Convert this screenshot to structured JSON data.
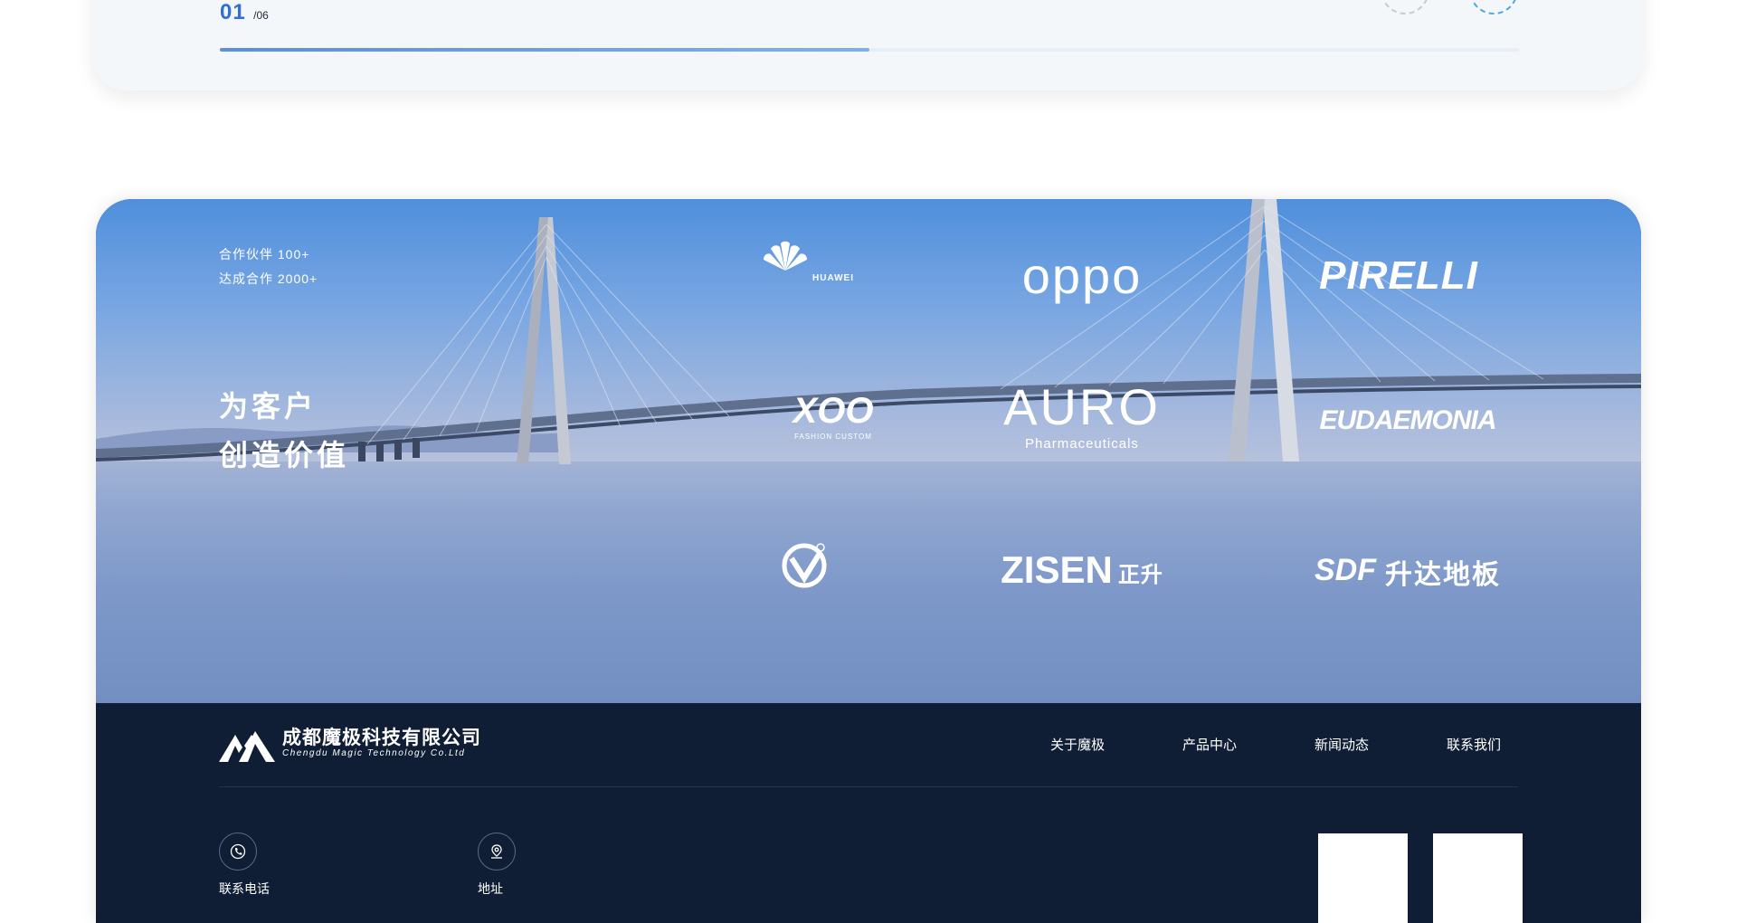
{
  "slider": {
    "current": "01",
    "total": "/06",
    "progress": 0.5
  },
  "stats": {
    "partners": "合作伙伴 100+",
    "deals": "达成合作 2000+"
  },
  "slogan": {
    "line1": "为客户",
    "line2": "创造价值"
  },
  "partners": [
    {
      "name": "HUAWEI"
    },
    {
      "name": "oppo"
    },
    {
      "name": "PIRELLI"
    },
    {
      "name": "XOO",
      "sub": "FASHION CUSTOM"
    },
    {
      "name": "AURO",
      "sub": "Pharmaceuticals"
    },
    {
      "name": "EUDAEMONIA"
    },
    {
      "name": "emblem"
    },
    {
      "name": "ZISEN",
      "sub": "正升"
    },
    {
      "name": "SDF",
      "sub": "升达地板"
    }
  ],
  "footer": {
    "company_name": "成都魔极科技有限公司",
    "company_en": "Chengdu Magic Technology Co.Ltd",
    "nav": [
      "关于魔极",
      "产品中心",
      "新闻动态",
      "联系我们"
    ],
    "contacts": [
      {
        "label": "联系电话",
        "icon": "phone-icon"
      },
      {
        "label": "地址",
        "icon": "location-icon"
      }
    ]
  },
  "colors": {
    "accent": "#2f6fd6",
    "footer_bg": "#0f1e35"
  }
}
